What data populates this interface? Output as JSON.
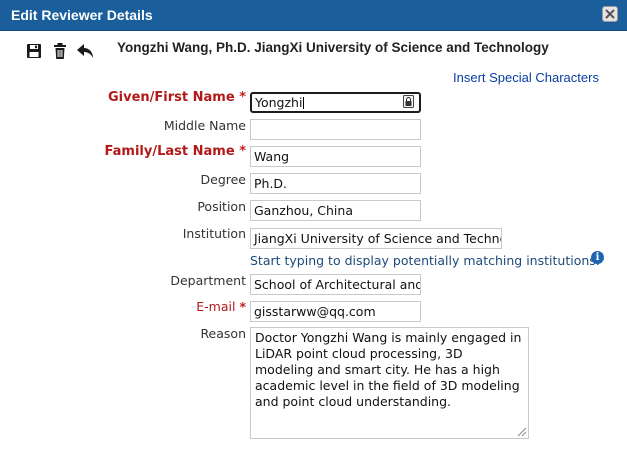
{
  "dialog": {
    "title": "Edit Reviewer Details",
    "close_icon": "close-icon"
  },
  "toolbar": {
    "icons": [
      "save-icon",
      "trash-icon",
      "back-arrow-icon"
    ]
  },
  "header": {
    "name_affiliation": "Yongzhi Wang, Ph.D. JiangXi University of Science and Technology"
  },
  "special_chars_link": "Insert Special Characters",
  "form": {
    "given_name": {
      "label": "Given/First Name",
      "value": "Yongzhi",
      "required": true
    },
    "middle_name": {
      "label": "Middle Name",
      "value": ""
    },
    "family_name": {
      "label": "Family/Last Name",
      "value": "Wang",
      "required": true
    },
    "degree": {
      "label": "Degree",
      "value": "Ph.D."
    },
    "position": {
      "label": "Position",
      "value": "Ganzhou, China"
    },
    "institution": {
      "label": "Institution",
      "value": "JiangXi University of Science and Technology",
      "hint": "Start typing to display potentially matching institutions."
    },
    "department": {
      "label": "Department",
      "value": "School of Architectural and Surveying Engineering"
    },
    "email": {
      "label": "E-mail",
      "value": "gisstarww@qq.com",
      "required": true
    },
    "reason": {
      "label": "Reason",
      "value": "Doctor Yongzhi Wang is mainly engaged in LiDAR point cloud processing, 3D modeling and smart city. He has a high academic level in the field of 3D modeling and point cloud understanding."
    }
  },
  "required_marker": "*",
  "info_glyph": "i",
  "colors": {
    "title_bar": "#1a5e9b",
    "required_label": "#b21a1a",
    "link": "#0b3ea3",
    "hint": "#1d4a7a",
    "info": "#1f63b5"
  }
}
